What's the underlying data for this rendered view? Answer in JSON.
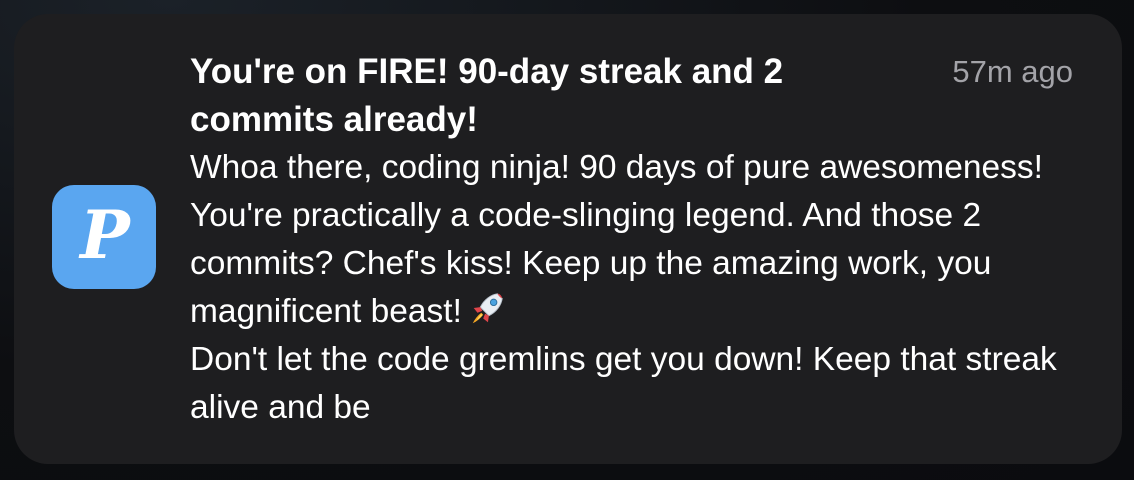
{
  "notification": {
    "app_icon": "p-app-icon",
    "app_icon_letter": "P",
    "app_icon_color": "#5aa6f0",
    "title": "You're on FIRE! 90-day streak and 2 commits already!",
    "timestamp": "57m ago",
    "body_part1": "Whoa there, coding ninja! 90 days of pure awesomeness! You're practically a code-slinging legend. And those 2 commits? Chef's kiss! Keep up the amazing work, you magnificent beast!",
    "body_emoji": "rocket-icon",
    "body_part2": "Don't let the code gremlins get you down! Keep that streak alive and be"
  }
}
